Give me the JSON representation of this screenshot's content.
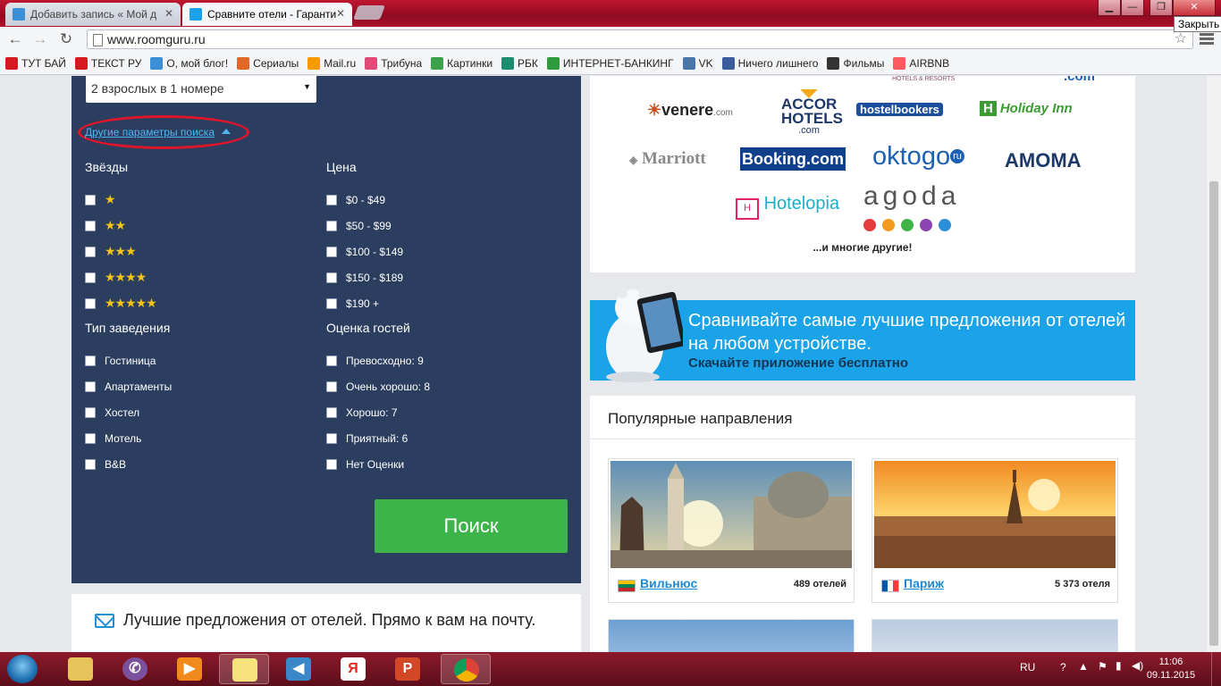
{
  "browser": {
    "tabs": [
      {
        "title": "Добавить запись « Мой д",
        "active": false
      },
      {
        "title": "Сравните отели - Гаранти",
        "active": true
      }
    ],
    "close_tooltip": "Закрыть",
    "url": "www.roomguru.ru",
    "bookmarks": [
      {
        "label": "ТУТ БАЙ",
        "icon": "magnet-icon",
        "color": "#d71920"
      },
      {
        "label": "ТЕКСТ РУ",
        "icon": "copyright-icon",
        "color": "#d71920"
      },
      {
        "label": "О, мой блог!",
        "icon": "blog-icon",
        "color": "#3b8fd6"
      },
      {
        "label": "Сериалы",
        "icon": "flame-icon",
        "color": "#e2682a"
      },
      {
        "label": "Mail.ru",
        "icon": "at-icon",
        "color": "#f59b00"
      },
      {
        "label": "Трибуна",
        "icon": "star-icon",
        "color": "#e24a7a"
      },
      {
        "label": "Картинки",
        "icon": "px-icon",
        "color": "#3aa34a"
      },
      {
        "label": "РБК",
        "icon": "rbc-icon",
        "color": "#1c8c6e"
      },
      {
        "label": "ИНТЕРНЕТ-БАНКИНГ",
        "icon": "bank-icon",
        "color": "#2e9c3d"
      },
      {
        "label": "VK",
        "icon": "vk-icon",
        "color": "#4a76a8"
      },
      {
        "label": "Ничего лишнего",
        "icon": "user-icon",
        "color": "#3b5d9c"
      },
      {
        "label": "Фильмы",
        "icon": "film-icon",
        "color": "#333333"
      },
      {
        "label": "AIRBNB",
        "icon": "airbnb-icon",
        "color": "#ff5a5f"
      }
    ]
  },
  "filters": {
    "guests_value": "2 взрослых в 1 номере",
    "more_params_link": "Другие параметры поиска",
    "stars": {
      "heading": "Звёзды",
      "options": [
        "★",
        "★★",
        "★★★",
        "★★★★",
        "★★★★★"
      ]
    },
    "price": {
      "heading": "Цена",
      "options": [
        "$0 - $49",
        "$50 - $99",
        "$100 - $149",
        "$150 - $189",
        "$190 +"
      ]
    },
    "property_type": {
      "heading": "Тип заведения",
      "options": [
        "Гостиница",
        "Апартаменты",
        "Хостел",
        "Мотель",
        "B&B"
      ]
    },
    "guest_rating": {
      "heading": "Оценка гостей",
      "options": [
        "Превосходно: 9",
        "Очень хорошо: 8",
        "Хорошо: 7",
        "Приятный: 6",
        "Нет Оценки"
      ]
    },
    "search_button": "Поиск"
  },
  "newsletter": {
    "text": "Лучшие предложения от отелей. Прямо к вам на почту."
  },
  "partners": {
    "top_partial": [
      "HOTELS & RESORTS",
      ".com"
    ],
    "logos": {
      "venere": "venere",
      "venere_suffix": ".com",
      "accor_1": "ACCOR",
      "accor_2": "HOTELS",
      "accor_3": ".com",
      "hostelbookers": "hostelbookers",
      "holidayinn": "Holiday Inn",
      "marriott": "Marriott",
      "booking": "Booking.com",
      "oktogo": "oktogo",
      "oktogo_ru": "ru",
      "amoma": "AMOMA",
      "hotelopia": "Hotelopia",
      "agoda": "agoda"
    },
    "more": "...и многие другие!"
  },
  "app_banner": {
    "line1": "Сравнивайте самые лучшие предложения от отелей на любом устройстве.",
    "line2": "Скачайте приложение бесплатно"
  },
  "popular": {
    "title": "Популярные направления",
    "destinations": [
      {
        "name": "Вильнюс",
        "count": "489 отелей"
      },
      {
        "name": "Париж",
        "count": "5 373 отеля"
      }
    ]
  },
  "taskbar": {
    "lang": "RU",
    "time": "11:06",
    "date": "09.11.2015"
  },
  "colors": {
    "panel": "#2c3e5f",
    "search_green": "#3db449",
    "link_blue": "#1f8ad3",
    "banner_blue": "#1aa3e8",
    "highlight_red": "#e0152a"
  }
}
